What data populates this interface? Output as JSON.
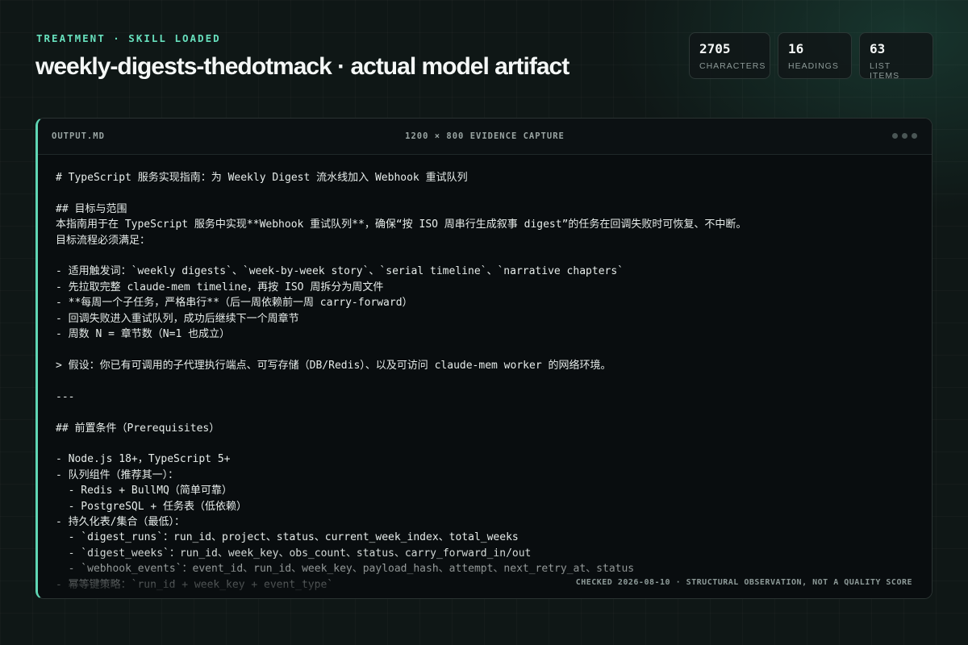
{
  "header": {
    "eyebrow": "TREATMENT · SKILL LOADED",
    "title": "weekly-digests-thedotmack · actual model artifact"
  },
  "stats": [
    {
      "value": "2705",
      "label": "CHARACTERS"
    },
    {
      "value": "16",
      "label": "HEADINGS"
    },
    {
      "value": "63",
      "label": "LIST ITEMS"
    }
  ],
  "panel": {
    "file_name": "OUTPUT.MD",
    "capture_label": "1200 × 800 EVIDENCE CAPTURE",
    "footer_note": "CHECKED 2026-08-10 · STRUCTURAL OBSERVATION, NOT A QUALITY SCORE",
    "content": "# TypeScript 服务实现指南：为 Weekly Digest 流水线加入 Webhook 重试队列\n\n## 目标与范围\n本指南用于在 TypeScript 服务中实现**Webhook 重试队列**，确保“按 ISO 周串行生成叙事 digest”的任务在回调失败时可恢复、不中断。\n目标流程必须满足：\n\n- 适用触发词：`weekly digests`、`week-by-week story`、`serial timeline`、`narrative chapters`\n- 先拉取完整 claude-mem timeline，再按 ISO 周拆分为周文件\n- **每周一个子任务，严格串行**（后一周依赖前一周 carry-forward）\n- 回调失败进入重试队列，成功后继续下一个周章节\n- 周数 N = 章节数（N=1 也成立）\n\n> 假设：你已有可调用的子代理执行端点、可写存储（DB/Redis）、以及可访问 claude-mem worker 的网络环境。\n\n---\n\n## 前置条件（Prerequisites）\n\n- Node.js 18+，TypeScript 5+\n- 队列组件（推荐其一）：\n  - Redis + BullMQ（简单可靠）\n  - PostgreSQL + 任务表（低依赖）\n- 持久化表/集合（最低）：\n  - `digest_runs`：run_id、project、status、current_week_index、total_weeks\n  - `digest_weeks`：run_id、week_key、obs_count、status、carry_forward_in/out\n  - `webhook_events`：event_id、run_id、week_key、payload_hash、attempt、next_retry_at、status\n- 幂等键策略：`run_id + week_key + event_type`"
  }
}
